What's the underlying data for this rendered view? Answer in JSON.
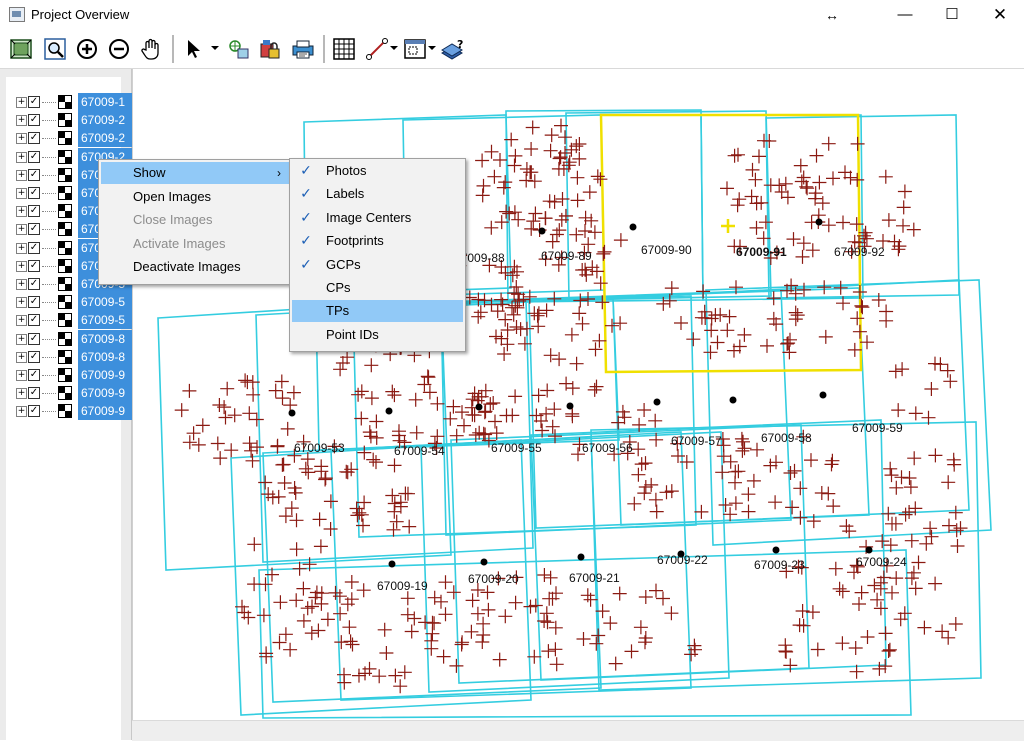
{
  "window": {
    "title": "Project Overview"
  },
  "toolbar": {
    "buttons": [
      {
        "icon": "full-extent-icon"
      },
      {
        "icon": "zoom-window-icon"
      },
      {
        "icon": "zoom-in-icon"
      },
      {
        "icon": "zoom-out-icon"
      },
      {
        "icon": "pan-hand-icon"
      },
      {
        "icon": "select-arrow-icon"
      },
      {
        "icon": "add-points-icon"
      },
      {
        "icon": "image-lock-icon"
      },
      {
        "icon": "print-icon"
      },
      {
        "icon": "grid-icon"
      },
      {
        "icon": "measure-icon"
      },
      {
        "icon": "view-options-icon"
      },
      {
        "icon": "help-book-icon"
      }
    ]
  },
  "tree": {
    "items": [
      {
        "label": "67009-1",
        "checked": true
      },
      {
        "label": "67009-2",
        "checked": true
      },
      {
        "label": "67009-2",
        "checked": true
      },
      {
        "label": "67009-2",
        "checked": true
      },
      {
        "label": "670",
        "checked": true
      },
      {
        "label": "670",
        "checked": true
      },
      {
        "label": "670",
        "checked": true
      },
      {
        "label": "670",
        "checked": true
      },
      {
        "label": "670",
        "checked": true
      },
      {
        "label": "670",
        "checked": true
      },
      {
        "label": "67009-5",
        "checked": true
      },
      {
        "label": "67009-5",
        "checked": true
      },
      {
        "label": "67009-5",
        "checked": true
      },
      {
        "label": "67009-8",
        "checked": true
      },
      {
        "label": "67009-8",
        "checked": true
      },
      {
        "label": "67009-9",
        "checked": true
      },
      {
        "label": "67009-9",
        "checked": true
      },
      {
        "label": "67009-9",
        "checked": true
      }
    ]
  },
  "context_menu": {
    "items": [
      {
        "label": "Show",
        "has_submenu": true,
        "state": "highlighted"
      },
      {
        "label": "Open Images",
        "state": "enabled"
      },
      {
        "label": "Close Images",
        "state": "disabled"
      },
      {
        "label": "Activate Images",
        "state": "disabled"
      },
      {
        "label": "Deactivate Images",
        "state": "enabled"
      }
    ]
  },
  "show_submenu": {
    "items": [
      {
        "label": "Photos",
        "checked": true
      },
      {
        "label": "Labels",
        "checked": true
      },
      {
        "label": "Image Centers",
        "checked": true
      },
      {
        "label": "Footprints",
        "checked": true
      },
      {
        "label": "GCPs",
        "checked": true
      },
      {
        "label": "CPs",
        "checked": false
      },
      {
        "label": "TPs",
        "checked": false,
        "highlighted": true
      },
      {
        "label": "Point IDs",
        "checked": false
      }
    ]
  },
  "map": {
    "colors": {
      "footprint": "#34cde0",
      "selected_footprint": "#f0e000",
      "tie_point": "#8b1a12",
      "center": "#000000"
    },
    "image_labels": [
      "67009-88",
      "67009-89",
      "67009-90",
      "67009-91",
      "67009-92",
      "67009-53",
      "67009-54",
      "67009-55",
      "67009-56",
      "67009-57",
      "67009-58",
      "67009-59",
      "67009-19",
      "67009-20",
      "67009-21",
      "67009-22",
      "67009-23",
      "67009-24"
    ],
    "selected_image": "67009-91"
  }
}
